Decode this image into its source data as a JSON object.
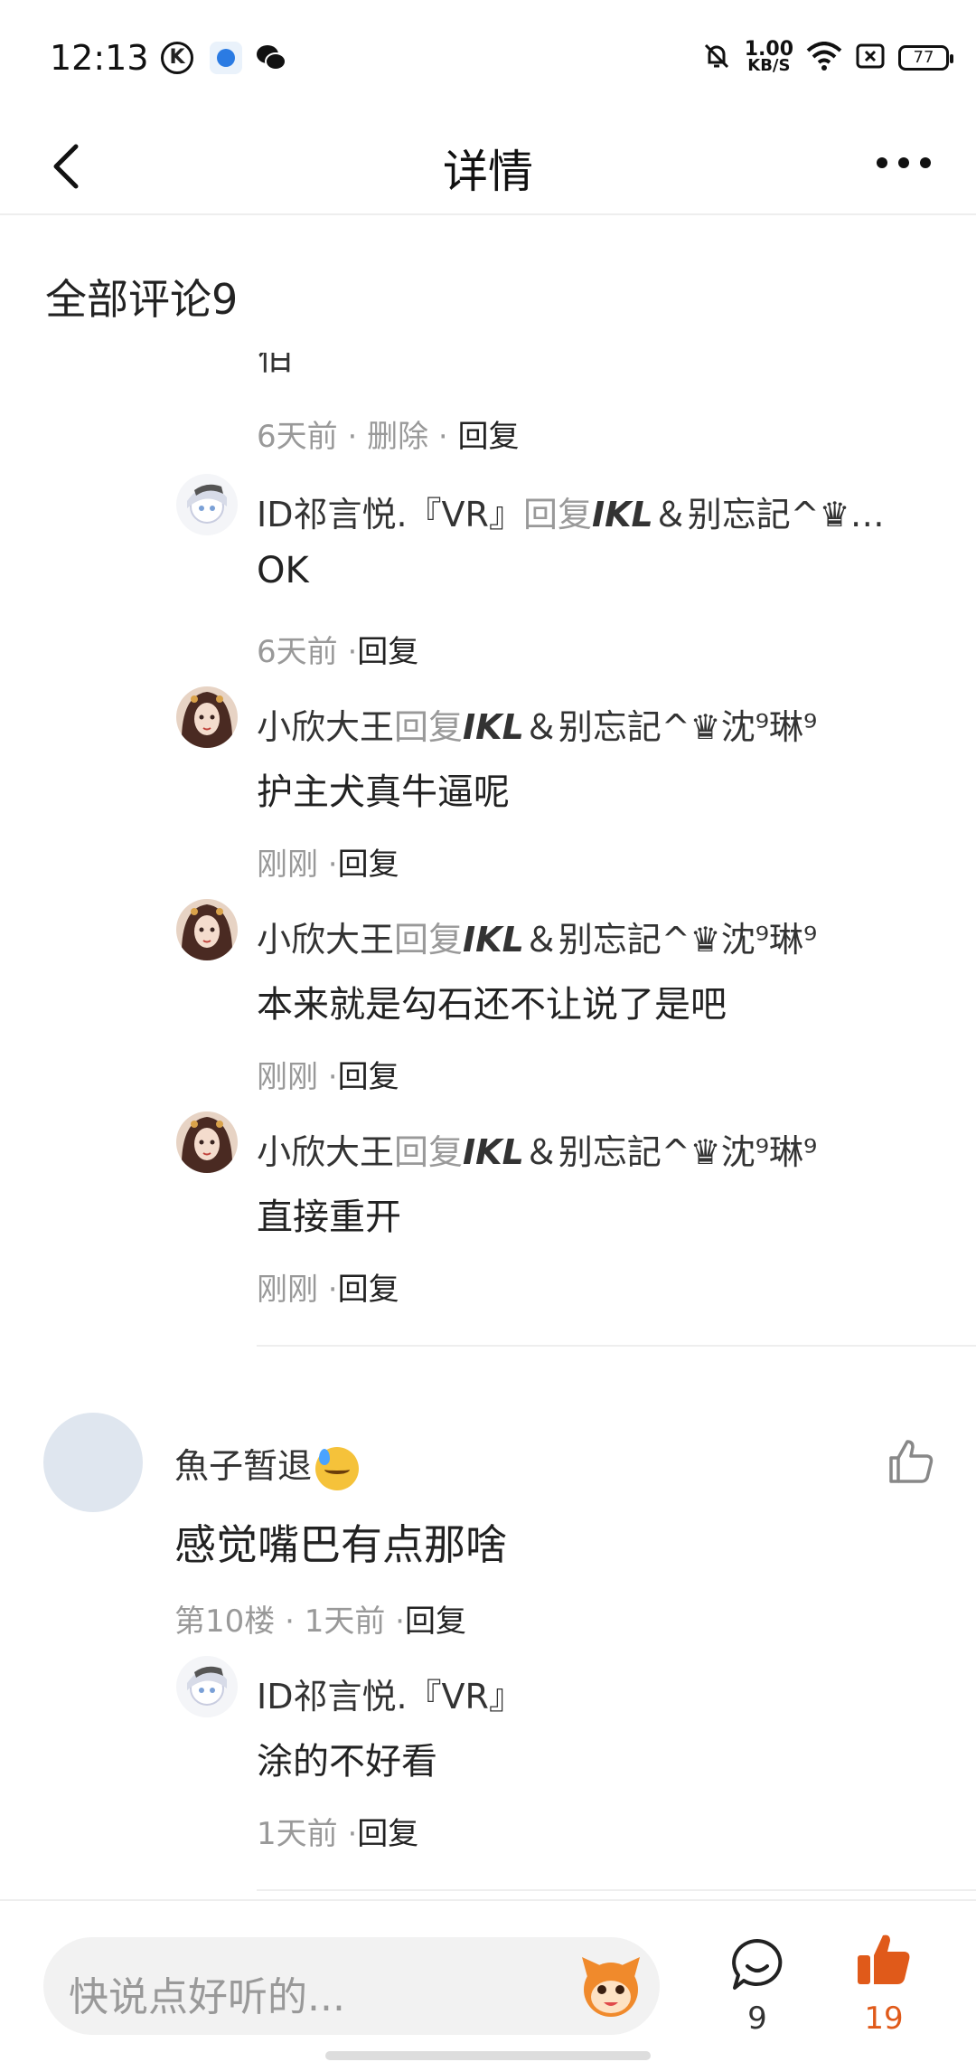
{
  "status_bar": {
    "time": "12:13",
    "speed_value": "1.00",
    "speed_unit": "KB/S",
    "battery": "77",
    "icons": [
      "k-app-icon",
      "q-app-icon",
      "wechat-icon",
      "mute-bell-icon",
      "wifi-icon",
      "sim-icon",
      "battery-icon"
    ]
  },
  "nav": {
    "title": "详情",
    "back_icon": "chevron-left-icon",
    "more_icon": "more-dots-icon"
  },
  "section": {
    "title": "全部评论9"
  },
  "partial_reply": {
    "text": "佰",
    "time": "6天前",
    "sep1": " · ",
    "delete": "删除",
    "sep2": " · ",
    "reply": "回复"
  },
  "replies": [
    {
      "name": "ID祁言悦.『VR』",
      "reply_word": "回复",
      "target": "IKL",
      "target_rest": "＆别忘記^♛…",
      "text": "OK",
      "time": "6天前",
      "sep": " ·",
      "reply": "回复"
    },
    {
      "name": "小欣大王",
      "reply_word": "回复",
      "target": "IKL",
      "target_rest": "＆别忘記^♛沈⁹琳⁹",
      "text": "护主犬真牛逼呢",
      "time": "刚刚",
      "sep": " ·",
      "reply": "回复"
    },
    {
      "name": "小欣大王",
      "reply_word": "回复",
      "target": "IKL",
      "target_rest": "＆别忘記^♛沈⁹琳⁹",
      "text": "本来就是勾石还不让说了是吧",
      "time": "刚刚",
      "sep": " ·",
      "reply": "回复"
    },
    {
      "name": "小欣大王",
      "reply_word": "回复",
      "target": "IKL",
      "target_rest": "＆别忘記^♛沈⁹琳⁹",
      "text": "直接重开",
      "time": "刚刚",
      "sep": " ·",
      "reply": "回复"
    }
  ],
  "main_comment": {
    "name": "魚子暂退",
    "emoji": "sad-sweat-emoji",
    "text": "感觉嘴巴有点那啥",
    "floor": "第10楼",
    "sep1": " · ",
    "time": "1天前",
    "sep2": " ·",
    "reply": "回复",
    "like_icon": "thumbs-up-outline-icon"
  },
  "sub_reply": {
    "name": "ID祁言悦.『VR』",
    "text": "涂的不好看",
    "time": "1天前",
    "sep": " ·",
    "reply": "回复"
  },
  "bottom_bar": {
    "placeholder": "快说点好听的...",
    "comment_count": "9",
    "like_count": "19",
    "accent": "#e05a1a"
  }
}
